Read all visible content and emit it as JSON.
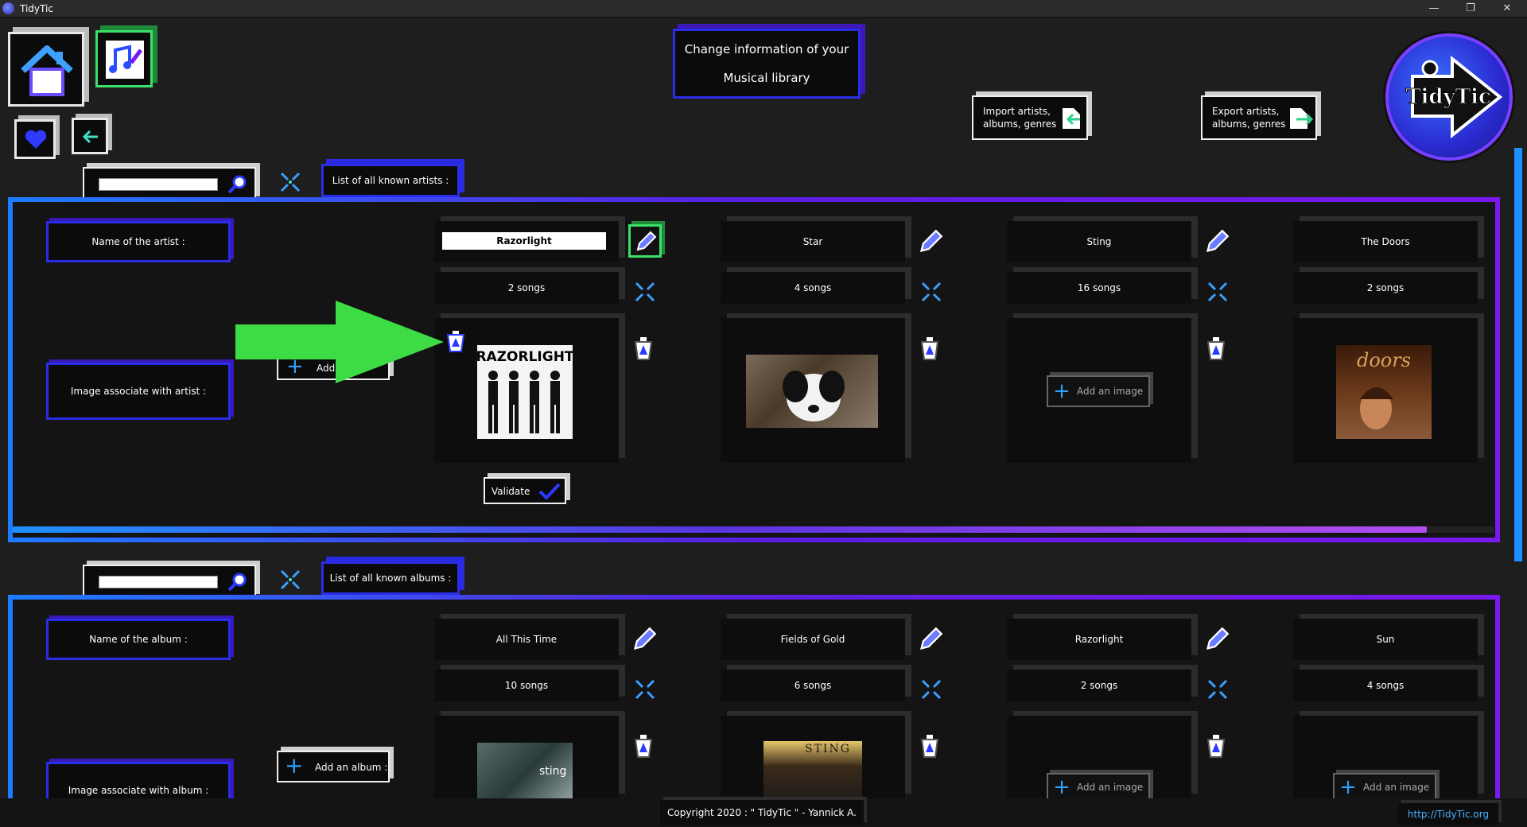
{
  "window": {
    "title": "TidyTic",
    "minimize": "—",
    "maximize": "❐",
    "close": "✕"
  },
  "header": {
    "title_line1": "Change information of your",
    "title_line2": "Musical library",
    "import_label_1": "Import artists,",
    "import_label_2": "albums, genres",
    "export_label_1": "Export artists,",
    "export_label_2": "albums, genres",
    "logo_text": "TidyTic"
  },
  "artists_section": {
    "list_label": "List of all known artists :",
    "name_label": "Name of the artist :",
    "image_label": "Image associate with artist :",
    "add_button": "Add",
    "validate_button": "Validate",
    "items": [
      {
        "name": "Razorlight",
        "songs": "2 songs",
        "image_caption": "RAZORLIGHT",
        "editing": true
      },
      {
        "name": "Star",
        "songs": "4 songs"
      },
      {
        "name": "Sting",
        "songs": "16 songs",
        "add_image": "Add an image"
      },
      {
        "name": "The Doors",
        "songs": "2 songs",
        "image_caption": "doors"
      }
    ]
  },
  "albums_section": {
    "list_label": "List of all known albums :",
    "name_label": "Name of the album :",
    "image_label": "Image associate with album :",
    "add_button": "Add an album :",
    "items": [
      {
        "name": "All This Time",
        "songs": "10 songs",
        "image_caption": "sting"
      },
      {
        "name": "Fields of Gold",
        "songs": "6 songs",
        "image_caption": "STING"
      },
      {
        "name": "Razorlight",
        "songs": "2 songs",
        "add_image": "Add an image"
      },
      {
        "name": "Sun",
        "songs": "4 songs",
        "add_image": "Add an image"
      }
    ]
  },
  "footer": {
    "copyright": "Copyright 2020 : \" TidyTic \" - Yannick A.",
    "link": "http://TidyTic.org"
  },
  "colors": {
    "accent_blue": "#1f7bff",
    "accent_purple": "#7a18f0",
    "arrow_green": "#3ddc45"
  }
}
